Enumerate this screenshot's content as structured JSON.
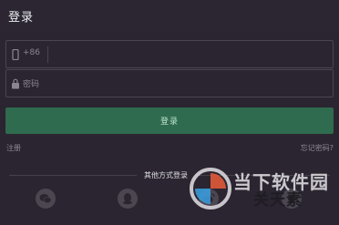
{
  "header": {
    "title": "登录"
  },
  "form": {
    "phone_prefix": "+86",
    "password_placeholder": "密码",
    "login_label": "登录",
    "register_label": "注册",
    "forgot_label": "忘记密码?"
  },
  "other_login": {
    "label": "其他方式登录",
    "icons": [
      "wechat-icon",
      "qq-icon",
      "weibo-icon",
      "more-icon"
    ]
  },
  "watermark": {
    "line1": "当下软件园",
    "line2": "关天素"
  },
  "colors": {
    "background": "#2a2530",
    "login_button": "#2f6b4e",
    "social_circle": "#4b4650"
  }
}
